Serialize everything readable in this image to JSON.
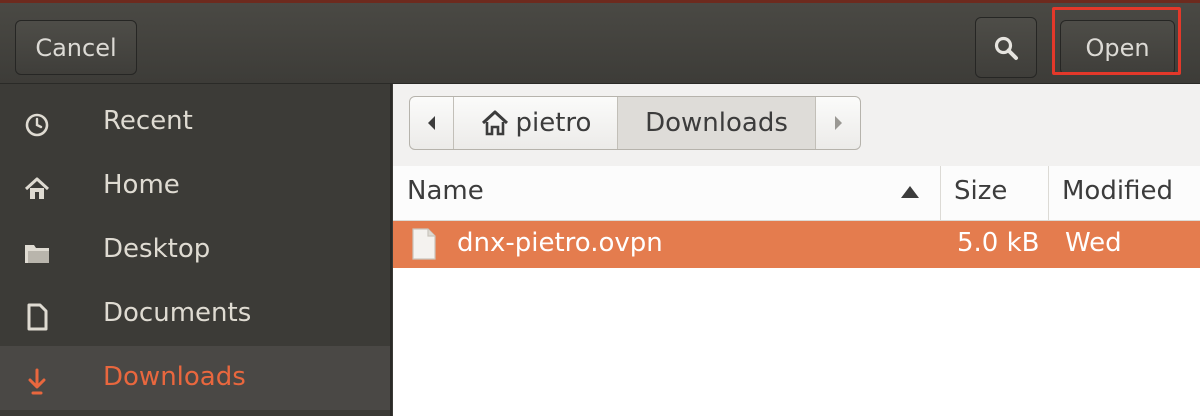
{
  "header": {
    "cancel_label": "Cancel",
    "search_icon": "search-icon",
    "open_label": "Open"
  },
  "sidebar": {
    "items": [
      {
        "label": "Recent",
        "icon": "clock-icon"
      },
      {
        "label": "Home",
        "icon": "home-icon"
      },
      {
        "label": "Desktop",
        "icon": "folder-icon"
      },
      {
        "label": "Documents",
        "icon": "document-icon"
      },
      {
        "label": "Downloads",
        "icon": "download-icon",
        "active": true
      }
    ]
  },
  "pathbar": {
    "home_label": "pietro",
    "current_label": "Downloads"
  },
  "list": {
    "columns": {
      "name": "Name",
      "size": "Size",
      "modified": "Modified"
    },
    "rows": [
      {
        "name": "dnx-pietro.ovpn",
        "size": "5.0 kB",
        "modified": "Wed",
        "selected": true
      }
    ]
  },
  "colors": {
    "accent": "#e47c4e",
    "active_sidebar_text": "#e9673e",
    "highlight_box": "#e3382a"
  }
}
